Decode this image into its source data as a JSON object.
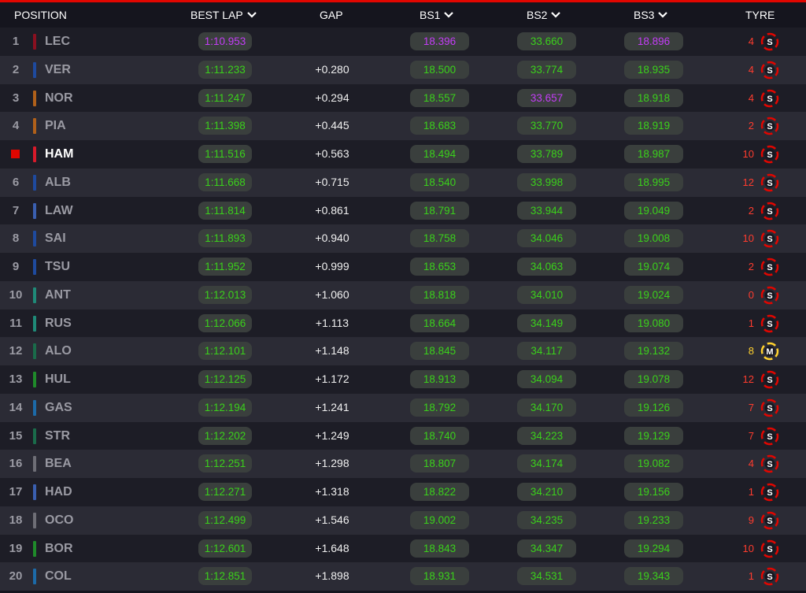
{
  "header": {
    "position": "POSITION",
    "best_lap": "BEST LAP",
    "gap": "GAP",
    "bs1": "BS1",
    "bs2": "BS2",
    "bs3": "BS3",
    "tyre": "TYRE"
  },
  "colors": {
    "accent": "#e10600",
    "green": "#3ad11b",
    "purple": "#c43df7",
    "soft_tyre": "#e10600",
    "medium_tyre": "#ffd12e"
  },
  "rows": [
    {
      "pos": "1",
      "code": "LEC",
      "team_color": "#8a1020",
      "best": "1:10.953",
      "best_c": "purple",
      "gap": "",
      "bs1": "18.396",
      "bs1_c": "purple",
      "bs2": "33.660",
      "bs2_c": "green",
      "bs3": "18.896",
      "bs3_c": "purple",
      "laps": "4",
      "tyre": "S"
    },
    {
      "pos": "2",
      "code": "VER",
      "team_color": "#1e4a9e",
      "best": "1:11.233",
      "best_c": "green",
      "gap": "+0.280",
      "bs1": "18.500",
      "bs1_c": "green",
      "bs2": "33.774",
      "bs2_c": "green",
      "bs3": "18.935",
      "bs3_c": "green",
      "laps": "4",
      "tyre": "S"
    },
    {
      "pos": "3",
      "code": "NOR",
      "team_color": "#b0601a",
      "best": "1:11.247",
      "best_c": "green",
      "gap": "+0.294",
      "bs1": "18.557",
      "bs1_c": "green",
      "bs2": "33.657",
      "bs2_c": "purple",
      "bs3": "18.918",
      "bs3_c": "green",
      "laps": "4",
      "tyre": "S"
    },
    {
      "pos": "4",
      "code": "PIA",
      "team_color": "#b0601a",
      "best": "1:11.398",
      "best_c": "green",
      "gap": "+0.445",
      "bs1": "18.683",
      "bs1_c": "green",
      "bs2": "33.770",
      "bs2_c": "green",
      "bs3": "18.919",
      "bs3_c": "green",
      "laps": "2",
      "tyre": "S"
    },
    {
      "pos": "",
      "code": "HAM",
      "team_color": "#d81a2a",
      "best": "1:11.516",
      "best_c": "green",
      "gap": "+0.563",
      "bs1": "18.494",
      "bs1_c": "green",
      "bs2": "33.789",
      "bs2_c": "green",
      "bs3": "18.987",
      "bs3_c": "green",
      "laps": "10",
      "tyre": "S",
      "highlight": true
    },
    {
      "pos": "6",
      "code": "ALB",
      "team_color": "#1e4a9e",
      "best": "1:11.668",
      "best_c": "green",
      "gap": "+0.715",
      "bs1": "18.540",
      "bs1_c": "green",
      "bs2": "33.998",
      "bs2_c": "green",
      "bs3": "18.995",
      "bs3_c": "green",
      "laps": "12",
      "tyre": "S"
    },
    {
      "pos": "7",
      "code": "LAW",
      "team_color": "#3a5fb0",
      "best": "1:11.814",
      "best_c": "green",
      "gap": "+0.861",
      "bs1": "18.791",
      "bs1_c": "green",
      "bs2": "33.944",
      "bs2_c": "green",
      "bs3": "19.049",
      "bs3_c": "green",
      "laps": "2",
      "tyre": "S"
    },
    {
      "pos": "8",
      "code": "SAI",
      "team_color": "#1e4a9e",
      "best": "1:11.893",
      "best_c": "green",
      "gap": "+0.940",
      "bs1": "18.758",
      "bs1_c": "green",
      "bs2": "34.046",
      "bs2_c": "green",
      "bs3": "19.008",
      "bs3_c": "green",
      "laps": "10",
      "tyre": "S"
    },
    {
      "pos": "9",
      "code": "TSU",
      "team_color": "#1e4a9e",
      "best": "1:11.952",
      "best_c": "green",
      "gap": "+0.999",
      "bs1": "18.653",
      "bs1_c": "green",
      "bs2": "34.063",
      "bs2_c": "green",
      "bs3": "19.074",
      "bs3_c": "green",
      "laps": "2",
      "tyre": "S"
    },
    {
      "pos": "10",
      "code": "ANT",
      "team_color": "#1f8a78",
      "best": "1:12.013",
      "best_c": "green",
      "gap": "+1.060",
      "bs1": "18.818",
      "bs1_c": "green",
      "bs2": "34.010",
      "bs2_c": "green",
      "bs3": "19.024",
      "bs3_c": "green",
      "laps": "0",
      "tyre": "S"
    },
    {
      "pos": "11",
      "code": "RUS",
      "team_color": "#1f8a78",
      "best": "1:12.066",
      "best_c": "green",
      "gap": "+1.113",
      "bs1": "18.664",
      "bs1_c": "green",
      "bs2": "34.149",
      "bs2_c": "green",
      "bs3": "19.080",
      "bs3_c": "green",
      "laps": "1",
      "tyre": "S"
    },
    {
      "pos": "12",
      "code": "ALO",
      "team_color": "#1a6b4a",
      "best": "1:12.101",
      "best_c": "green",
      "gap": "+1.148",
      "bs1": "18.845",
      "bs1_c": "green",
      "bs2": "34.117",
      "bs2_c": "green",
      "bs3": "19.132",
      "bs3_c": "green",
      "laps": "8",
      "tyre": "M"
    },
    {
      "pos": "13",
      "code": "HUL",
      "team_color": "#1f8a2a",
      "best": "1:12.125",
      "best_c": "green",
      "gap": "+1.172",
      "bs1": "18.913",
      "bs1_c": "green",
      "bs2": "34.094",
      "bs2_c": "green",
      "bs3": "19.078",
      "bs3_c": "green",
      "laps": "12",
      "tyre": "S"
    },
    {
      "pos": "14",
      "code": "GAS",
      "team_color": "#1c6aa8",
      "best": "1:12.194",
      "best_c": "green",
      "gap": "+1.241",
      "bs1": "18.792",
      "bs1_c": "green",
      "bs2": "34.170",
      "bs2_c": "green",
      "bs3": "19.126",
      "bs3_c": "green",
      "laps": "7",
      "tyre": "S"
    },
    {
      "pos": "15",
      "code": "STR",
      "team_color": "#1a6b4a",
      "best": "1:12.202",
      "best_c": "green",
      "gap": "+1.249",
      "bs1": "18.740",
      "bs1_c": "green",
      "bs2": "34.223",
      "bs2_c": "green",
      "bs3": "19.129",
      "bs3_c": "green",
      "laps": "7",
      "tyre": "S"
    },
    {
      "pos": "16",
      "code": "BEA",
      "team_color": "#6e6e76",
      "best": "1:12.251",
      "best_c": "green",
      "gap": "+1.298",
      "bs1": "18.807",
      "bs1_c": "green",
      "bs2": "34.174",
      "bs2_c": "green",
      "bs3": "19.082",
      "bs3_c": "green",
      "laps": "4",
      "tyre": "S"
    },
    {
      "pos": "17",
      "code": "HAD",
      "team_color": "#3a5fb0",
      "best": "1:12.271",
      "best_c": "green",
      "gap": "+1.318",
      "bs1": "18.822",
      "bs1_c": "green",
      "bs2": "34.210",
      "bs2_c": "green",
      "bs3": "19.156",
      "bs3_c": "green",
      "laps": "1",
      "tyre": "S"
    },
    {
      "pos": "18",
      "code": "OCO",
      "team_color": "#6e6e76",
      "best": "1:12.499",
      "best_c": "green",
      "gap": "+1.546",
      "bs1": "19.002",
      "bs1_c": "green",
      "bs2": "34.235",
      "bs2_c": "green",
      "bs3": "19.233",
      "bs3_c": "green",
      "laps": "9",
      "tyre": "S"
    },
    {
      "pos": "19",
      "code": "BOR",
      "team_color": "#1f8a2a",
      "best": "1:12.601",
      "best_c": "green",
      "gap": "+1.648",
      "bs1": "18.843",
      "bs1_c": "green",
      "bs2": "34.347",
      "bs2_c": "green",
      "bs3": "19.294",
      "bs3_c": "green",
      "laps": "10",
      "tyre": "S"
    },
    {
      "pos": "20",
      "code": "COL",
      "team_color": "#1c6aa8",
      "best": "1:12.851",
      "best_c": "green",
      "gap": "+1.898",
      "bs1": "18.931",
      "bs1_c": "green",
      "bs2": "34.531",
      "bs2_c": "green",
      "bs3": "19.343",
      "bs3_c": "green",
      "laps": "1",
      "tyre": "S"
    }
  ]
}
